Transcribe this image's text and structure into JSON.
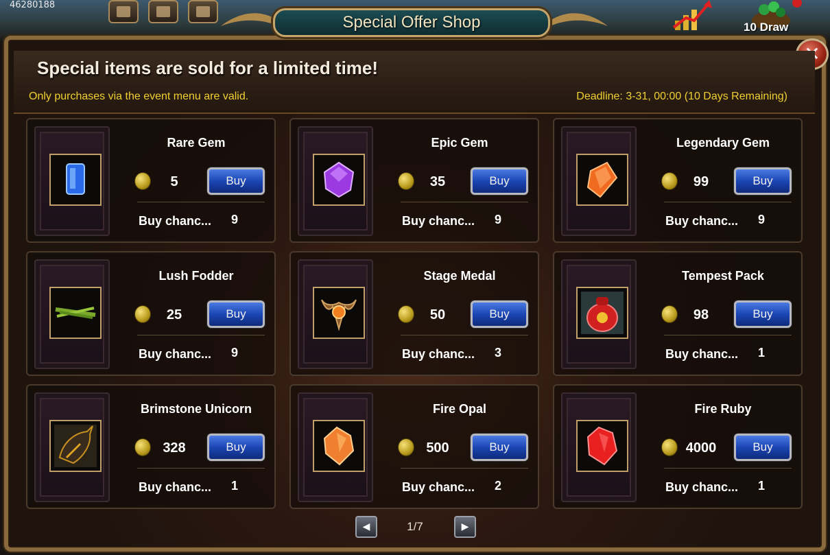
{
  "topbar": {
    "player_id": "46280188",
    "draw_label": "10 Draw"
  },
  "window": {
    "title": "Special Offer Shop",
    "close_label": "✕"
  },
  "header": {
    "headline": "Special items are sold for a limited time!",
    "note": "Only purchases via the event menu are valid.",
    "deadline": "Deadline: 3-31, 00:00 (10 Days Remaining)"
  },
  "shop": {
    "buy_label": "Buy",
    "chance_label": "Buy chanc...",
    "items": [
      {
        "name": "Rare Gem",
        "price": "5",
        "chance": "9",
        "icon": "rare-gem-icon",
        "color": "#2a6ae8"
      },
      {
        "name": "Epic Gem",
        "price": "35",
        "chance": "9",
        "icon": "epic-gem-icon",
        "color": "#9a3ae0"
      },
      {
        "name": "Legendary Gem",
        "price": "99",
        "chance": "9",
        "icon": "legendary-gem-icon",
        "color": "#f06a20"
      },
      {
        "name": "Lush Fodder",
        "price": "25",
        "chance": "9",
        "icon": "fodder-icon",
        "color": "#7aa82a"
      },
      {
        "name": "Stage Medal",
        "price": "50",
        "chance": "3",
        "icon": "medal-icon",
        "color": "#c87a2a"
      },
      {
        "name": "Tempest Pack",
        "price": "98",
        "chance": "1",
        "icon": "pack-icon",
        "color": "#d02020"
      },
      {
        "name": "Brimstone Unicorn",
        "price": "328",
        "chance": "1",
        "icon": "unicorn-icon",
        "color": "#c89020"
      },
      {
        "name": "Fire Opal",
        "price": "500",
        "chance": "2",
        "icon": "fire-opal-icon",
        "color": "#f08030"
      },
      {
        "name": "Fire Ruby",
        "price": "4000",
        "chance": "1",
        "icon": "fire-ruby-icon",
        "color": "#e82020"
      }
    ]
  },
  "pager": {
    "prev": "◀",
    "next": "▶",
    "page": "1/7"
  }
}
